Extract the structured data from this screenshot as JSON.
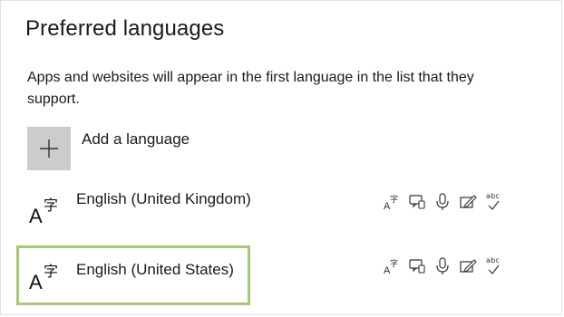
{
  "section": {
    "title": "Preferred languages",
    "description": "Apps and websites will appear in the first language in the list that they support."
  },
  "add_language": {
    "label": "Add a language",
    "icon": "plus-icon"
  },
  "languages": [
    {
      "name": "English (United Kingdom)",
      "icon": "language-icon",
      "selected": false,
      "features": [
        "display-language-icon",
        "speech-icon",
        "microphone-icon",
        "handwriting-icon",
        "spell-check-icon"
      ],
      "spell_check_text": "abc"
    },
    {
      "name": "English (United States)",
      "icon": "language-icon",
      "selected": true,
      "features": [
        "display-language-icon",
        "speech-icon",
        "microphone-icon",
        "handwriting-icon",
        "spell-check-icon"
      ],
      "spell_check_text": "abc"
    }
  ],
  "colors": {
    "selection_border": "#a6c878",
    "add_button_bg": "#cccccc",
    "text": "#1a1a1a"
  }
}
